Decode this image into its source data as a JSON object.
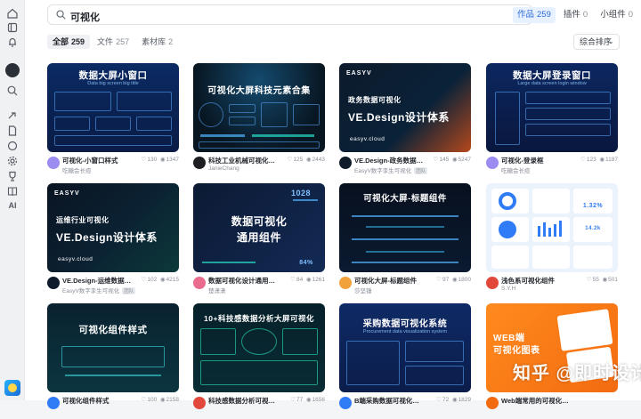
{
  "search": {
    "value": "可视化"
  },
  "scopes": [
    {
      "label": "作品",
      "count": "259"
    },
    {
      "label": "插件",
      "count": "0"
    },
    {
      "label": "小组件",
      "count": "0"
    }
  ],
  "filters": [
    {
      "label": "全部",
      "count": "259"
    },
    {
      "label": "文件",
      "count": "257"
    },
    {
      "label": "素材库",
      "count": "2"
    }
  ],
  "sort": {
    "label": "综合排序"
  },
  "rail": {
    "ai_label": "AI"
  },
  "cards": [
    {
      "thumb_title": "数据大屏小窗口",
      "thumb_sub": "Data big screen big title",
      "name": "可视化-小窗口样式",
      "author": "吃糖会长痘",
      "likes": "130",
      "views": "1347",
      "tag": ""
    },
    {
      "thumb_title": "可视化大屏科技元素合集",
      "thumb_sub": "",
      "name": "科技工业机械可视化大数...",
      "author": "JanieChang",
      "likes": "125",
      "views": "2443",
      "tag": ""
    },
    {
      "thumb_title": "VE.Design设计体系",
      "thumb_kicker": "政务数据可视化",
      "thumb_brand": "EASYV",
      "thumb_foot": "easyv.cloud",
      "name": "VE.Design-政务数据可视化",
      "author": "EasyV数字孪生可视化",
      "likes": "145",
      "views": "5247",
      "tag": "团队"
    },
    {
      "thumb_title": "数据大屏登录窗口",
      "thumb_sub": "Large data screen login window",
      "name": "可视化-登录框",
      "author": "吃糖会长痘",
      "likes": "123",
      "views": "1187",
      "tag": ""
    },
    {
      "thumb_title": "VE.Design设计体系",
      "thumb_kicker": "运维行业可视化",
      "thumb_brand": "EASYV",
      "thumb_foot": "easyv.cloud",
      "name": "VE.Design-运维数据可视化",
      "author": "EasyV数字孪生可视化",
      "likes": "102",
      "views": "4215",
      "tag": "团队"
    },
    {
      "thumb_title": "数据可视化",
      "thumb_title2": "通用组件",
      "thumb_num": "1028",
      "thumb_pct": "84%",
      "name": "数据可视化设计通用组件",
      "author": "楚潇潇",
      "likes": "84",
      "views": "1261",
      "tag": ""
    },
    {
      "thumb_title": "可视化大屏-标题组件",
      "name": "可视化大屏-标题组件",
      "author": "莎坚锤",
      "likes": "97",
      "views": "1800",
      "tag": ""
    },
    {
      "thumb_big": "1.32%",
      "thumb_small": "14.2k",
      "name": "浅色系可视化组件",
      "author": "S.Y.H",
      "likes": "55",
      "views": "501",
      "tag": ""
    },
    {
      "thumb_title": "可视化组件样式",
      "name": "可视化组件样式",
      "author": "",
      "likes": "100",
      "views": "2158",
      "tag": ""
    },
    {
      "thumb_title": "10+科技感数据分析大屏可视化",
      "name": "科技感数据分析可视化大屏",
      "author": "",
      "likes": "77",
      "views": "1656",
      "tag": ""
    },
    {
      "thumb_title": "采购数据可视化系统",
      "thumb_sub": "Procurement data visualization system",
      "name": "B端采购数据可视化系统",
      "author": "",
      "likes": "72",
      "views": "1829",
      "tag": ""
    },
    {
      "thumb_title": "WEB端",
      "thumb_title2": "可视化图表",
      "name": "Web端常用的可视化图表",
      "author": "",
      "likes": "",
      "views": "",
      "tag": ""
    }
  ],
  "watermark": "知乎 @即时设计"
}
